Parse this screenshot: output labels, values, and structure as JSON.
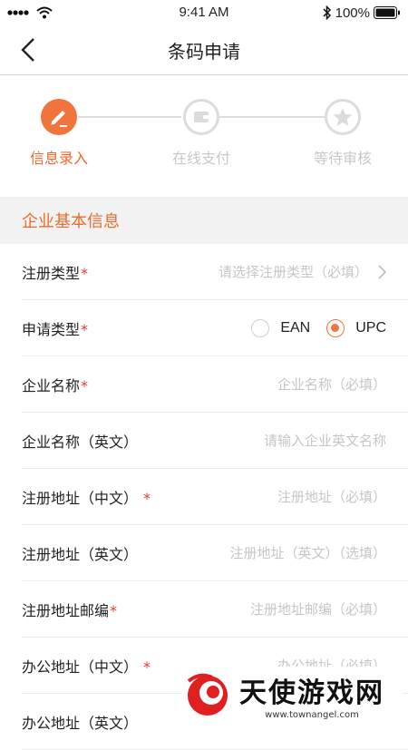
{
  "status_bar": {
    "time": "9:41 AM",
    "battery": "100%"
  },
  "nav": {
    "title": "条码申请"
  },
  "steps": [
    {
      "label": "信息录入",
      "state": "active"
    },
    {
      "label": "在线支付",
      "state": "inactive"
    },
    {
      "label": "等待审核",
      "state": "inactive"
    }
  ],
  "section": {
    "title": "企业基本信息"
  },
  "form": {
    "rows": [
      {
        "label": "注册类型",
        "required": "*",
        "placeholder": "请选择注册类型（必填）"
      },
      {
        "label": "申请类型",
        "required": "*"
      },
      {
        "label": "企业名称",
        "required": "*",
        "placeholder": "企业名称（必填）"
      },
      {
        "label": "企业名称（英文）",
        "required": "",
        "placeholder": "请输入企业英文名称"
      },
      {
        "label": "注册地址（中文）",
        "required": "*",
        "placeholder": "注册地址（必填）"
      },
      {
        "label": "注册地址（英文）",
        "required": "",
        "placeholder": "注册地址（英文）（选填）"
      },
      {
        "label": "注册地址邮编",
        "required": "*",
        "placeholder": "注册地址邮编（必填）"
      },
      {
        "label": "办公地址（中文）",
        "required": "*",
        "placeholder": "办公地址（必填）"
      },
      {
        "label": "办公地址（英文）",
        "required": "",
        "placeholder": ""
      }
    ],
    "apply_type_options": [
      {
        "label": "EAN",
        "selected": false
      },
      {
        "label": "UPC",
        "selected": true
      }
    ]
  },
  "watermark": {
    "brand": "天使游戏网",
    "url": "www.townangel.com"
  },
  "colors": {
    "accent": "#f1743c",
    "required": "#e53935",
    "placeholder": "#c6c6c6"
  }
}
